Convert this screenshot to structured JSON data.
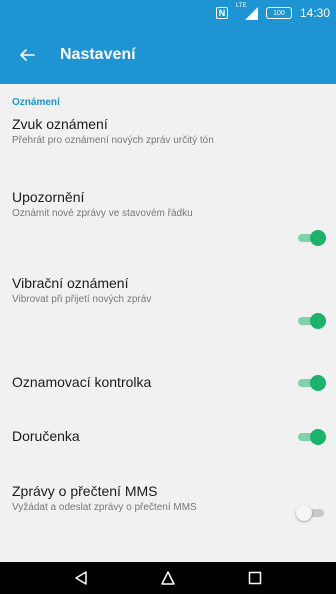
{
  "status_bar": {
    "nfc_label": "N",
    "network_label": "LTE",
    "battery_level": "100",
    "time": "14:30",
    "icons": [
      "nfc-icon",
      "signal-icon",
      "battery-icon"
    ]
  },
  "app_bar": {
    "title": "Nastavení",
    "back_icon": "arrow-left-icon"
  },
  "section": {
    "header": "Oznámení"
  },
  "prefs": [
    {
      "title": "Zvuk oznámení",
      "summary": "Přehrát pro oznámení nových zpráv určitý tón",
      "has_switch": false
    },
    {
      "title": "Upozornění",
      "summary": "Oznámit nové zprávy ve stavovém řádku",
      "has_switch": true,
      "on": true
    },
    {
      "title": "Vibrační oznámení",
      "summary": "Vibrovat při přijetí nových zpráv",
      "has_switch": true,
      "on": true
    },
    {
      "title": "Oznamovací kontrolka",
      "summary": "",
      "has_switch": true,
      "on": true
    },
    {
      "title": "Doručenka",
      "summary": "",
      "has_switch": true,
      "on": true
    },
    {
      "title": "Zprávy o přečtení MMS",
      "summary": "Vyžádat a odeslat zprávy o přečtení MMS",
      "has_switch": true,
      "on": false
    }
  ],
  "nav_bar": {
    "icons": [
      "back-triangle-icon",
      "home-icon",
      "recents-icon"
    ]
  },
  "colors": {
    "primary": "#1e94d2",
    "switch_on": "#1db26b",
    "switch_on_track": "#7fd2aa",
    "background": "#f1f1f1"
  }
}
